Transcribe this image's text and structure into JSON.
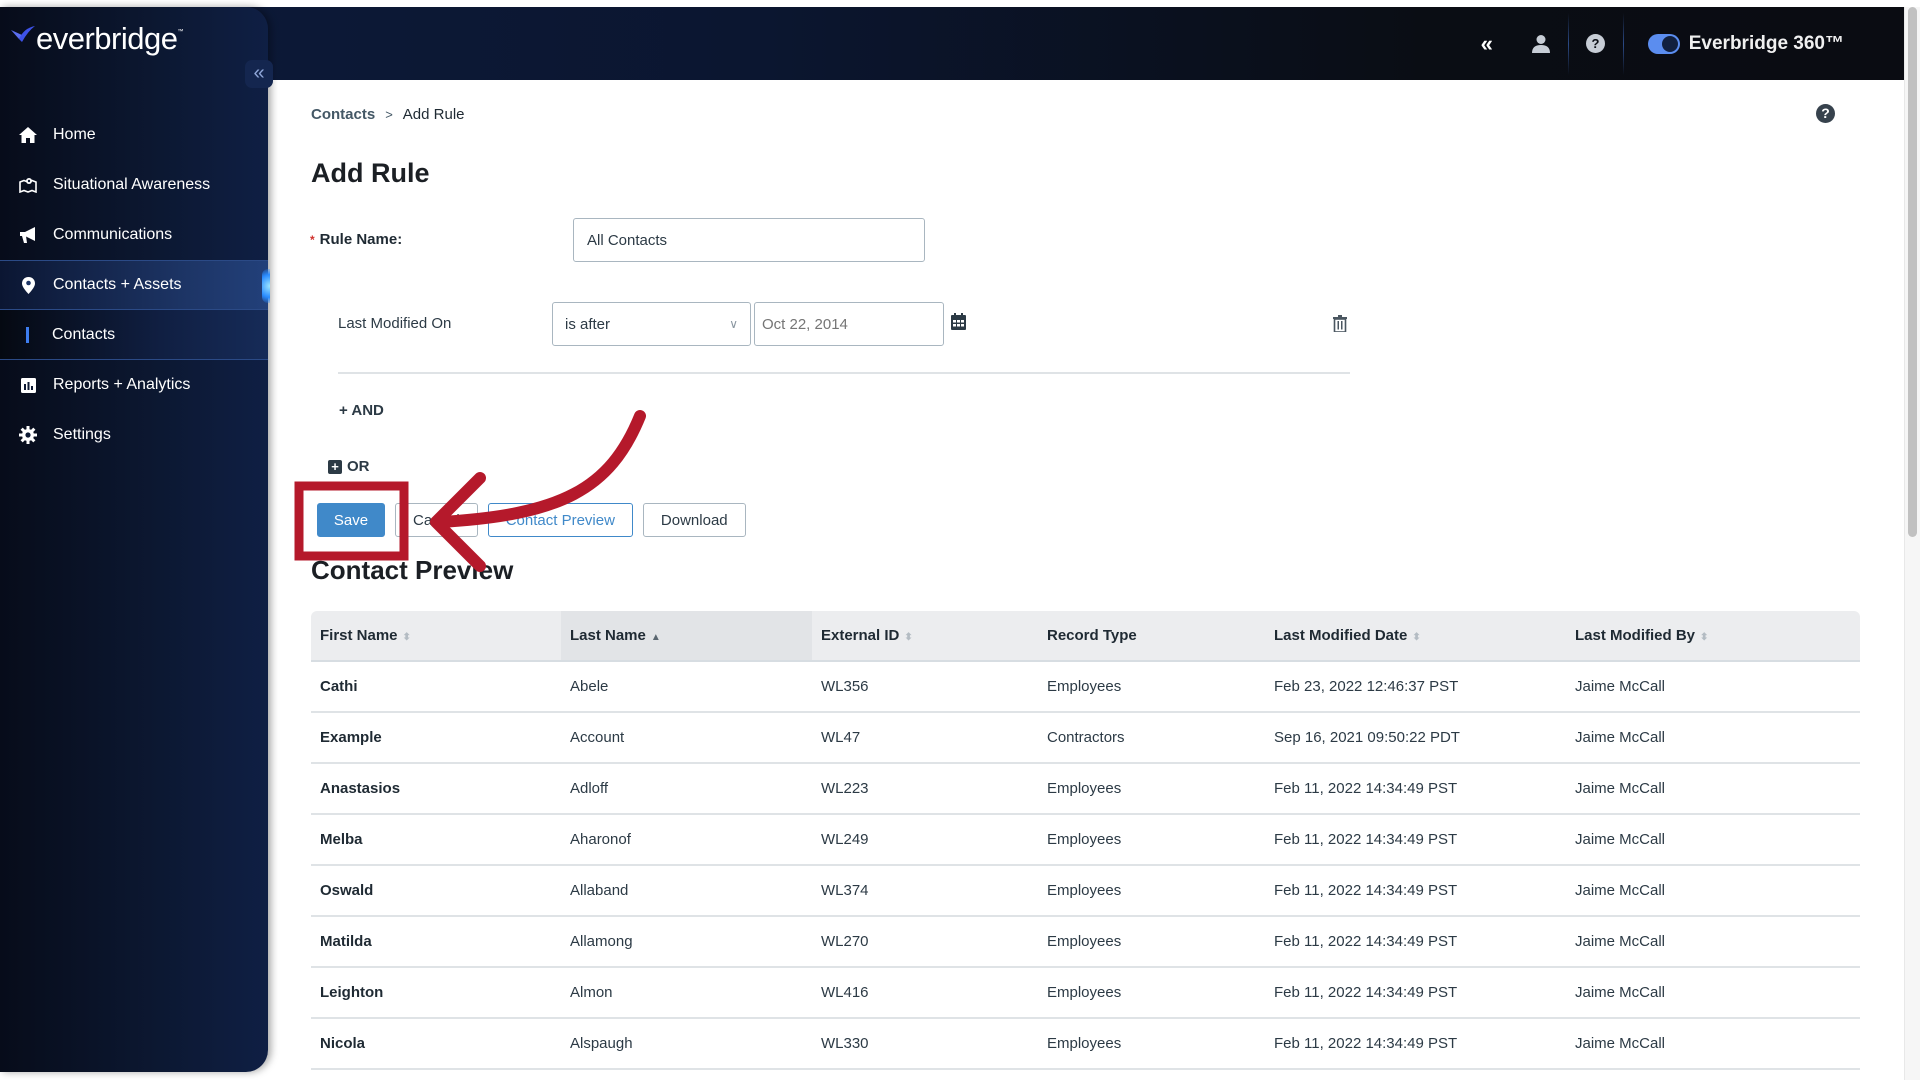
{
  "app": {
    "brand": "everbridge",
    "brand_tm": "™",
    "product_toggle_label": "Everbridge 360™",
    "product_toggle_on": true,
    "accent_color": "#4089c9",
    "annotation_color": "#b5192b"
  },
  "header": {
    "icons": [
      "collapse-double-chevron-icon",
      "user-icon",
      "help-icon"
    ]
  },
  "sidebar": {
    "collapse_icon": "«",
    "items": [
      {
        "label": "Home",
        "icon": "home-icon"
      },
      {
        "label": "Situational Awareness",
        "icon": "map-pin-icon"
      },
      {
        "label": "Communications",
        "icon": "megaphone-icon"
      },
      {
        "label": "Contacts + Assets",
        "icon": "location-marker-icon",
        "active": true
      },
      {
        "label": "Contacts",
        "sub": true,
        "active": true
      },
      {
        "label": "Reports + Analytics",
        "icon": "bar-chart-icon"
      },
      {
        "label": "Settings",
        "icon": "gear-icon"
      }
    ]
  },
  "breadcrumb": {
    "parent": "Contacts",
    "separator": ">",
    "current": "Add Rule"
  },
  "page": {
    "title": "Add Rule",
    "rule_name_label": "Rule Name:",
    "rule_name_required": "*",
    "rule_name_value": "All Contacts",
    "condition": {
      "field": "Last Modified On",
      "operator": "is after",
      "date_placeholder": "Oct 22, 2014"
    },
    "and_label": "+ AND",
    "or_label": "OR",
    "buttons": {
      "save": "Save",
      "cancel": "Cancel",
      "contact_preview": "Contact Preview",
      "download": "Download"
    }
  },
  "preview": {
    "title": "Contact Preview",
    "columns": [
      {
        "label": "First Name",
        "sortable": true
      },
      {
        "label": "Last Name",
        "sortable": true,
        "sorted": "asc"
      },
      {
        "label": "External ID",
        "sortable": true
      },
      {
        "label": "Record Type",
        "sortable": false
      },
      {
        "label": "Last Modified Date",
        "sortable": true
      },
      {
        "label": "Last Modified By",
        "sortable": true
      }
    ],
    "rows": [
      [
        "Cathi",
        "Abele",
        "WL356",
        "Employees",
        "Feb 23, 2022 12:46:37 PST",
        "Jaime McCall"
      ],
      [
        "Example",
        "Account",
        "WL47",
        "Contractors",
        "Sep 16, 2021 09:50:22 PDT",
        "Jaime McCall"
      ],
      [
        "Anastasios",
        "Adloff",
        "WL223",
        "Employees",
        "Feb 11, 2022 14:34:49 PST",
        "Jaime McCall"
      ],
      [
        "Melba",
        "Aharonof",
        "WL249",
        "Employees",
        "Feb 11, 2022 14:34:49 PST",
        "Jaime McCall"
      ],
      [
        "Oswald",
        "Allaband",
        "WL374",
        "Employees",
        "Feb 11, 2022 14:34:49 PST",
        "Jaime McCall"
      ],
      [
        "Matilda",
        "Allamong",
        "WL270",
        "Employees",
        "Feb 11, 2022 14:34:49 PST",
        "Jaime McCall"
      ],
      [
        "Leighton",
        "Almon",
        "WL416",
        "Employees",
        "Feb 11, 2022 14:34:49 PST",
        "Jaime McCall"
      ],
      [
        "Nicola",
        "Alspaugh",
        "WL330",
        "Employees",
        "Feb 11, 2022 14:34:49 PST",
        "Jaime McCall"
      ]
    ]
  }
}
